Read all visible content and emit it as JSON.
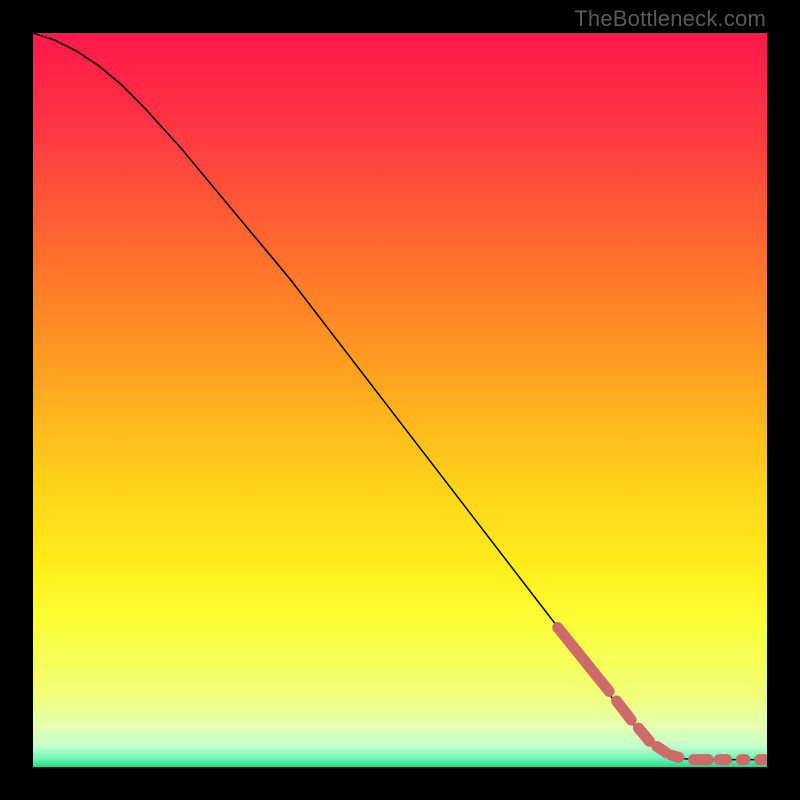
{
  "watermark": "TheBottleneck.com",
  "chart_data": {
    "type": "line",
    "title": "",
    "xlabel": "",
    "ylabel": "",
    "xlim": [
      0,
      100
    ],
    "ylim": [
      0,
      100
    ],
    "grid": false,
    "legend": false,
    "series": [
      {
        "name": "curve",
        "style": "solid",
        "color": "#000000",
        "width": 1.5,
        "x": [
          0,
          3,
          6,
          9,
          12,
          15,
          20,
          25,
          30,
          35,
          40,
          45,
          50,
          55,
          60,
          65,
          70,
          75,
          80,
          83,
          85,
          88,
          90,
          93,
          96,
          100
        ],
        "y": [
          100,
          99,
          97.5,
          95.5,
          93,
          90,
          84.5,
          78.5,
          72.5,
          66.5,
          60,
          53.5,
          47,
          40.5,
          34,
          27.5,
          21,
          14.5,
          8,
          4.3,
          2.5,
          1.2,
          1,
          1,
          1,
          1
        ]
      },
      {
        "name": "highlight-dashes",
        "style": "dashed-rounded",
        "color": "#cd6a6a",
        "width": 11,
        "segments": [
          {
            "x": [
              71.5,
              78.5
            ],
            "y": [
              19.0,
              10.3
            ]
          },
          {
            "x": [
              79.5,
              81.5
            ],
            "y": [
              9.0,
              6.4
            ]
          },
          {
            "x": [
              82.5,
              84.0
            ],
            "y": [
              5.3,
              3.5
            ]
          },
          {
            "x": [
              85.0,
              86.2
            ],
            "y": [
              2.8,
              2.0
            ]
          },
          {
            "x": [
              87.0,
              88.0
            ],
            "y": [
              1.6,
              1.3
            ]
          },
          {
            "x": [
              90.0,
              92.0
            ],
            "y": [
              1.0,
              1.0
            ]
          },
          {
            "x": [
              93.5,
              94.5
            ],
            "y": [
              1.0,
              1.0
            ]
          },
          {
            "x": [
              96.5,
              97.0
            ],
            "y": [
              1.0,
              1.0
            ]
          },
          {
            "x": [
              99.0,
              100.0
            ],
            "y": [
              1.0,
              1.0
            ]
          }
        ]
      }
    ],
    "background_gradient": {
      "stops": [
        {
          "offset": 0.0,
          "color": "#ff1a4b"
        },
        {
          "offset": 0.06,
          "color": "#ff2548"
        },
        {
          "offset": 0.14,
          "color": "#ff3a42"
        },
        {
          "offset": 0.24,
          "color": "#ff5a36"
        },
        {
          "offset": 0.34,
          "color": "#ff7a2a"
        },
        {
          "offset": 0.44,
          "color": "#ff9a22"
        },
        {
          "offset": 0.54,
          "color": "#ffbb1c"
        },
        {
          "offset": 0.64,
          "color": "#ffd81a"
        },
        {
          "offset": 0.74,
          "color": "#fff01f"
        },
        {
          "offset": 0.8,
          "color": "#fcfe37"
        },
        {
          "offset": 0.86,
          "color": "#f5ff5a"
        },
        {
          "offset": 0.91,
          "color": "#f0ff82"
        },
        {
          "offset": 0.945,
          "color": "#e4ffb0"
        },
        {
          "offset": 0.972,
          "color": "#c3ffcd"
        },
        {
          "offset": 0.988,
          "color": "#72f7b8"
        },
        {
          "offset": 1.0,
          "color": "#1edc8b"
        }
      ]
    }
  }
}
